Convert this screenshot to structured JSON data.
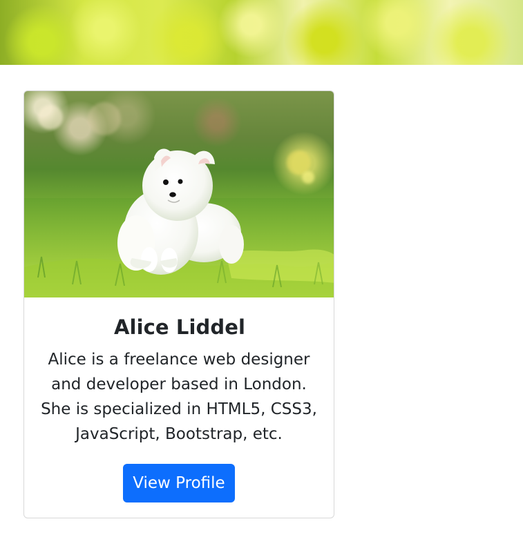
{
  "banner": {
    "image_name": "blurred green nature background"
  },
  "profile_card": {
    "image_name": "white fluffy puppy in grass",
    "name": "Alice Liddel",
    "description": "Alice is a freelance web designer and developer based in London. She is specialized in HTML5, CSS3, JavaScript, Bootstrap, etc.",
    "button_label": "View Profile",
    "button_color": "#0d6efd"
  }
}
